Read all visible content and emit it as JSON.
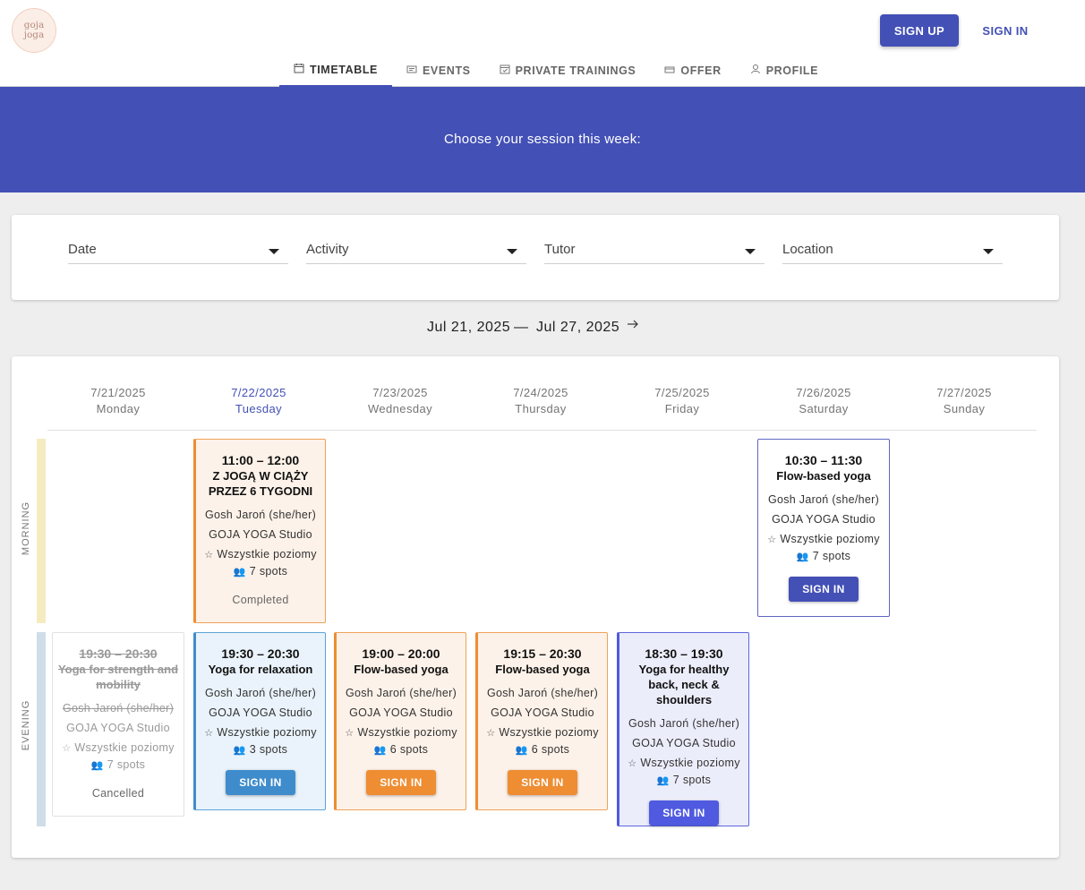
{
  "logo": {
    "line1": "goja",
    "line2": "joga"
  },
  "header": {
    "signup_label": "SIGN UP",
    "signin_label": "SIGN IN"
  },
  "tabs": [
    {
      "label": "TIMETABLE",
      "icon": "calendar-icon"
    },
    {
      "label": "EVENTS",
      "icon": "ticket-icon"
    },
    {
      "label": "PRIVATE TRAININGS",
      "icon": "calendar-check-icon"
    },
    {
      "label": "OFFER",
      "icon": "card-icon"
    },
    {
      "label": "PROFILE",
      "icon": "person-icon"
    }
  ],
  "banner": {
    "text": "Choose your session this week:"
  },
  "filters": {
    "date": "Date",
    "activity": "Activity",
    "tutor": "Tutor",
    "location": "Location"
  },
  "week": {
    "from": "Jul 21, 2025",
    "separator": "—",
    "to": "Jul 27, 2025",
    "next_icon": "arrow-right-icon"
  },
  "days": [
    {
      "date": "7/21/2025",
      "name": "Monday"
    },
    {
      "date": "7/22/2025",
      "name": "Tuesday"
    },
    {
      "date": "7/23/2025",
      "name": "Wednesday"
    },
    {
      "date": "7/24/2025",
      "name": "Thursday"
    },
    {
      "date": "7/25/2025",
      "name": "Friday"
    },
    {
      "date": "7/26/2025",
      "name": "Saturday"
    },
    {
      "date": "7/27/2025",
      "name": "Sunday"
    }
  ],
  "bands": {
    "morning": "MORNING",
    "evening": "EVENING"
  },
  "sessions": {
    "tue_morning": {
      "time": "11:00 – 12:00",
      "title": "Z JOGĄ W CIĄŻY PRZEZ 6 TYGODNI",
      "tutor": "Gosh Jaroń (she/her)",
      "location": "GOJA YOGA Studio",
      "level": "Wszystkie poziomy",
      "spots": "7 spots",
      "status": "Completed"
    },
    "sat_morning": {
      "time": "10:30 – 11:30",
      "title": "Flow-based yoga",
      "tutor": "Gosh Jaroń (she/her)",
      "location": "GOJA YOGA Studio",
      "level": "Wszystkie poziomy",
      "spots": "7 spots",
      "button": "SIGN IN"
    },
    "mon_evening": {
      "time": "19:30 – 20:30",
      "title": "Yoga for strength and mobility",
      "tutor": "Gosh Jaroń (she/her)",
      "location": "GOJA YOGA Studio",
      "level": "Wszystkie poziomy",
      "spots": "7 spots",
      "status": "Cancelled"
    },
    "tue_evening": {
      "time": "19:30 – 20:30",
      "title": "Yoga for relaxation",
      "tutor": "Gosh Jaroń (she/her)",
      "location": "GOJA YOGA Studio",
      "level": "Wszystkie poziomy",
      "spots": "3 spots",
      "button": "SIGN IN"
    },
    "wed_evening": {
      "time": "19:00 – 20:00",
      "title": "Flow-based yoga",
      "tutor": "Gosh Jaroń (she/her)",
      "location": "GOJA YOGA Studio",
      "level": "Wszystkie poziomy",
      "spots": "6 spots",
      "button": "SIGN IN"
    },
    "thu_evening": {
      "time": "19:15 – 20:30",
      "title": "Flow-based yoga",
      "tutor": "Gosh Jaroń (she/her)",
      "location": "GOJA YOGA Studio",
      "level": "Wszystkie poziomy",
      "spots": "6 spots",
      "button": "SIGN IN"
    },
    "fri_evening": {
      "time": "18:30 – 19:30",
      "title": "Yoga for healthy back, neck & shoulders",
      "tutor": "Gosh Jaroń (she/her)",
      "location": "GOJA YOGA Studio",
      "level": "Wszystkie poziomy",
      "spots": "7 spots",
      "button": "SIGN IN"
    }
  },
  "colors": {
    "primary": "#4350b5",
    "orange": "#ee8d32",
    "blue": "#3f8ccc",
    "indigo": "#4f5ae0",
    "morning_band": "#f5ebc1",
    "evening_band": "#cfdde9"
  }
}
